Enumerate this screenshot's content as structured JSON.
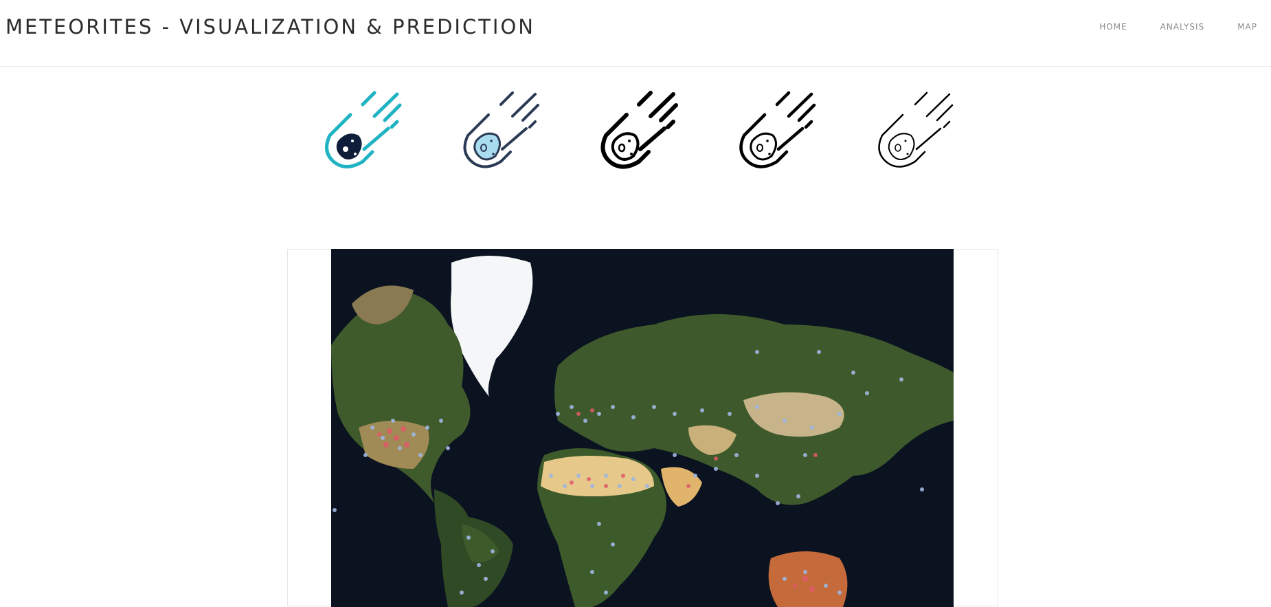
{
  "header": {
    "title": "METEORITES - VISUALIZATION & PREDICTION",
    "nav": [
      {
        "label": "HOME"
      },
      {
        "label": "ANALYSIS"
      },
      {
        "label": "MAP"
      }
    ]
  },
  "icons": [
    {
      "name": "meteor-icon-teal",
      "stroke": "#1fb3c3",
      "fill": "#0f1d3a"
    },
    {
      "name": "meteor-icon-navy",
      "stroke": "#2b3a55",
      "fill": "#a9dcef"
    },
    {
      "name": "meteor-icon-black-bold",
      "stroke": "#000000",
      "fill": "#ffffff"
    },
    {
      "name": "meteor-icon-black-medium",
      "stroke": "#000000",
      "fill": "#ffffff"
    },
    {
      "name": "meteor-icon-black-thin",
      "stroke": "#000000",
      "fill": "#ffffff"
    }
  ],
  "map": {
    "kind": "world-satellite-map",
    "marker_colors": {
      "point": "#9fb6e0",
      "dense": "#e05a6a"
    }
  }
}
